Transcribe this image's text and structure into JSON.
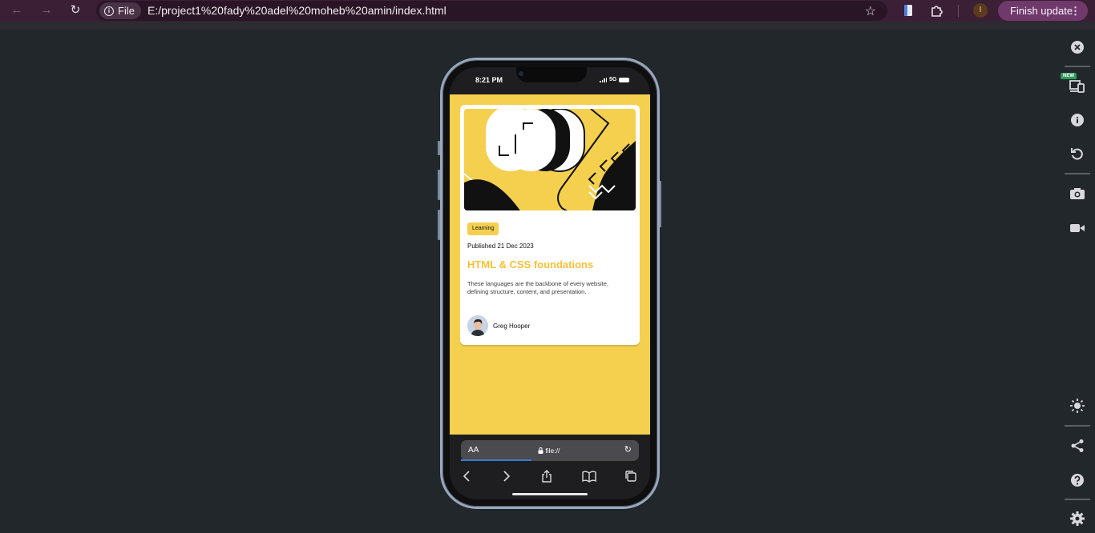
{
  "browser": {
    "back": "←",
    "forward": "→",
    "reload": "↻",
    "file_label": "File",
    "url": "E:/project1%20fady%20adel%20moheb%20amin/index.html",
    "star": "☆",
    "profile_initial": "I",
    "finish_update": "Finish update",
    "menu_dots": "⋮"
  },
  "devtools_sidebar": {
    "new_badge": "NEW",
    "icons": [
      "close-icon",
      "device-toolbar-icon",
      "info-icon",
      "rotate-icon",
      "screenshot-icon",
      "record-icon",
      "brightness-icon",
      "share-icon",
      "help-icon",
      "settings-icon"
    ]
  },
  "phone": {
    "time": "8:21 PM",
    "network": "5G"
  },
  "card": {
    "tag": "Learning",
    "published": "Published 21 Dec 2023",
    "title": "HTML & CSS foundations",
    "description": "These languages are the backbone of every website, defining structure, content, and presentation.",
    "author": "Greg Hooper"
  },
  "safari": {
    "aa": "AA",
    "url": "file://",
    "reload": "↻"
  },
  "colors": {
    "accent_yellow": "#f4d04e",
    "title_yellow": "#f4c13a",
    "browser_top": "#3a1f35",
    "finish_button": "#6f3a6b",
    "page_bg": "#22272b"
  }
}
